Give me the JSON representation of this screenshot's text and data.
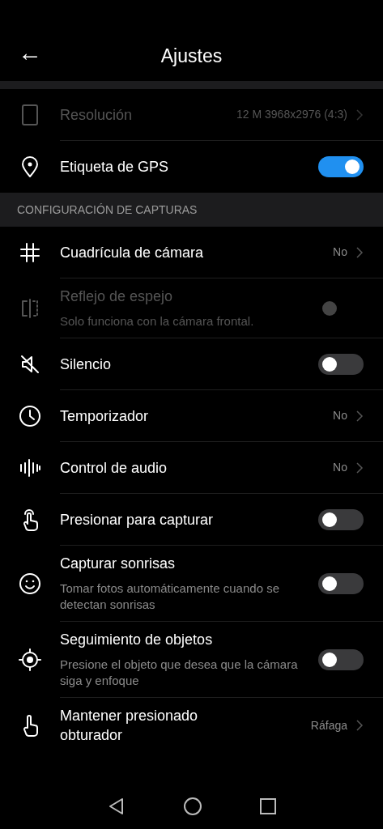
{
  "header": {
    "back": "←",
    "title": "Ajustes"
  },
  "groups": [
    {
      "items": [
        {
          "kind": "link",
          "title": "Resolución",
          "value": "12 M 3968x2976 (4:3)",
          "disabled": true
        },
        {
          "kind": "switch",
          "title": "Etiqueta de GPS",
          "on": true,
          "disabled": false
        }
      ]
    },
    {
      "header": "CONFIGURACIÓN DE CAPTURAS",
      "items": [
        {
          "kind": "link",
          "title": "Cuadrícula de cámara",
          "value": "No",
          "disabled": false
        },
        {
          "kind": "switch",
          "title": "Reflejo de espejo",
          "subtitle": "Solo funciona con la cámara frontal.",
          "on": false,
          "disabled": true
        },
        {
          "kind": "switch",
          "title": "Silencio",
          "on": false,
          "disabled": false
        },
        {
          "kind": "link",
          "title": "Temporizador",
          "value": "No",
          "disabled": false
        },
        {
          "kind": "link",
          "title": "Control de audio",
          "value": "No",
          "disabled": false
        },
        {
          "kind": "switch",
          "title": "Presionar para capturar",
          "on": false,
          "disabled": false
        },
        {
          "kind": "switch",
          "title": "Capturar sonrisas",
          "subtitle": "Tomar fotos automáticamente cuando se detectan sonrisas",
          "on": false,
          "disabled": false
        },
        {
          "kind": "switch",
          "title": "Seguimiento de objetos",
          "subtitle": "Presione el objeto que desea que la cámara siga y enfoque",
          "on": false,
          "disabled": false
        },
        {
          "kind": "link",
          "title": "Mantener presionado obturador",
          "value": "Ráfaga",
          "disabled": false
        }
      ]
    }
  ]
}
